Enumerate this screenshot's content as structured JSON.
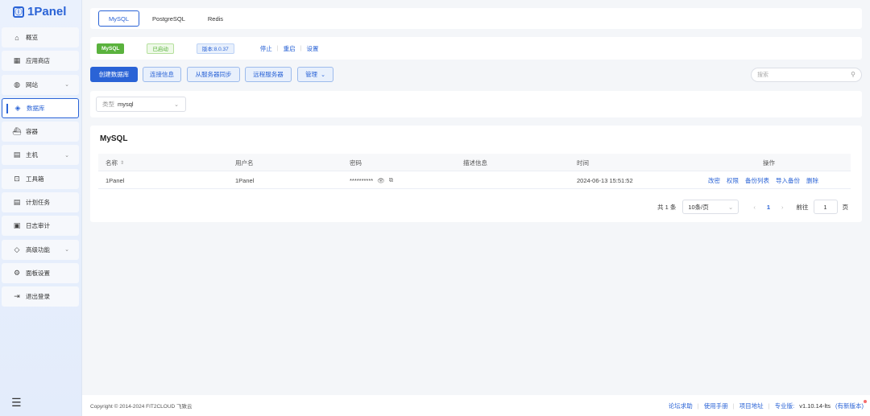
{
  "app": {
    "name": "1Panel"
  },
  "sidebar": {
    "items": [
      {
        "label": "概览",
        "icon": "home-icon"
      },
      {
        "label": "应用商店",
        "icon": "grid-icon"
      },
      {
        "label": "网站",
        "icon": "globe-icon",
        "expandable": true
      },
      {
        "label": "数据库",
        "icon": "database-icon",
        "active": true
      },
      {
        "label": "容器",
        "icon": "container-icon"
      },
      {
        "label": "主机",
        "icon": "server-icon",
        "expandable": true
      },
      {
        "label": "工具箱",
        "icon": "toolbox-icon"
      },
      {
        "label": "计划任务",
        "icon": "task-icon"
      },
      {
        "label": "日志审计",
        "icon": "log-icon"
      },
      {
        "label": "高级功能",
        "icon": "diamond-icon",
        "expandable": true
      },
      {
        "label": "面板设置",
        "icon": "settings-icon"
      },
      {
        "label": "退出登录",
        "icon": "logout-icon"
      }
    ]
  },
  "tabs": [
    "MySQL",
    "PostgreSQL",
    "Redis"
  ],
  "status": {
    "db_badge": "MySQL",
    "running": "已启动",
    "version": "版本:8.0.37",
    "stop": "停止",
    "restart": "重启",
    "settings": "设置"
  },
  "toolbar": {
    "create": "创建数据库",
    "connection": "连接信息",
    "sync": "从服务器同步",
    "remote": "远程服务器",
    "manage": "管理",
    "search_placeholder": "搜索"
  },
  "filter": {
    "label": "类型",
    "value": "mysql"
  },
  "table": {
    "title": "MySQL",
    "columns": [
      "名称",
      "用户名",
      "密码",
      "描述信息",
      "时间",
      "操作"
    ],
    "rows": [
      {
        "name": "1Panel",
        "username": "1Panel",
        "password": "**********",
        "description": "",
        "time": "2024-06-13 15:51:52",
        "actions": [
          "改密",
          "权限",
          "备份列表",
          "导入备份",
          "删除"
        ]
      }
    ]
  },
  "pagination": {
    "total": "共 1 条",
    "page_size": "10条/页",
    "current": "1",
    "goto_label": "前往",
    "goto_value": "1",
    "page_unit": "页"
  },
  "footer": {
    "copyright": "Copyright © 2014-2024 FIT2CLOUD 飞致云",
    "forum": "论坛求助",
    "manual": "使用手册",
    "project": "项目地址",
    "edition": "专业版:",
    "version": "v1.10.14-lts",
    "new_version": "(有新版本)"
  }
}
